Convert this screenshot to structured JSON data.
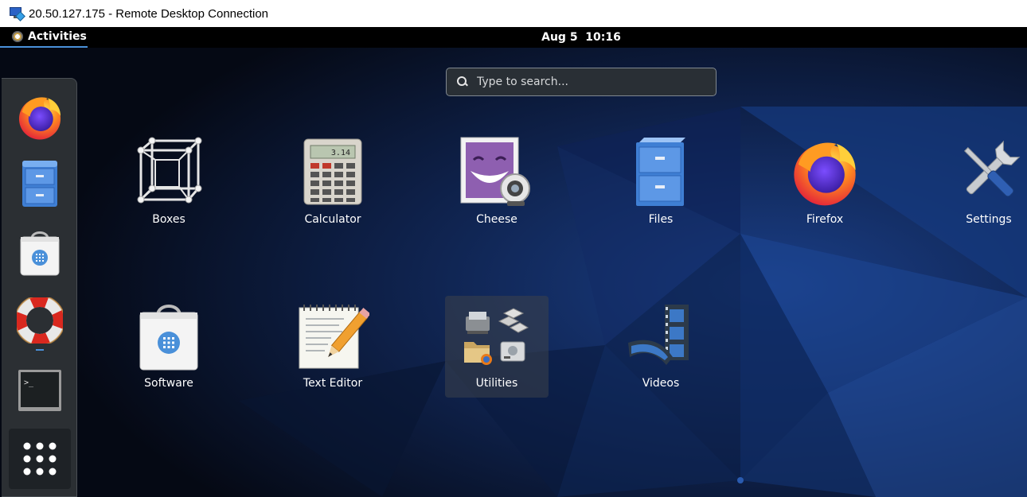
{
  "window": {
    "title": "20.50.127.175 - Remote Desktop Connection"
  },
  "topbar": {
    "activities": "Activities",
    "clock": "Aug 5  10:16"
  },
  "search": {
    "placeholder": "Type to search..."
  },
  "dash": {
    "items": [
      {
        "name": "firefox",
        "icon": "firefox-icon"
      },
      {
        "name": "files",
        "icon": "files-icon"
      },
      {
        "name": "software",
        "icon": "software-icon"
      },
      {
        "name": "help",
        "icon": "help-lifebuoy-icon",
        "running": true
      },
      {
        "name": "terminal",
        "icon": "terminal-icon"
      },
      {
        "name": "show-applications",
        "icon": "app-grid-icon"
      }
    ]
  },
  "apps": [
    {
      "label": "Boxes",
      "icon": "boxes-icon"
    },
    {
      "label": "Calculator",
      "icon": "calculator-icon"
    },
    {
      "label": "Cheese",
      "icon": "cheese-icon"
    },
    {
      "label": "Files",
      "icon": "files-icon"
    },
    {
      "label": "Firefox",
      "icon": "firefox-icon"
    },
    {
      "label": "Settings",
      "icon": "settings-icon"
    },
    {
      "label": "Software",
      "icon": "software-icon"
    },
    {
      "label": "Text Editor",
      "icon": "text-editor-icon"
    },
    {
      "label": "Utilities",
      "icon": "utilities-folder-icon",
      "selected": true
    },
    {
      "label": "Videos",
      "icon": "videos-icon"
    }
  ],
  "calculator_display": "3.14",
  "colors": {
    "accent": "#4a90d9",
    "desktop_bg": "#081022",
    "dash_bg": "#2b2f33"
  }
}
